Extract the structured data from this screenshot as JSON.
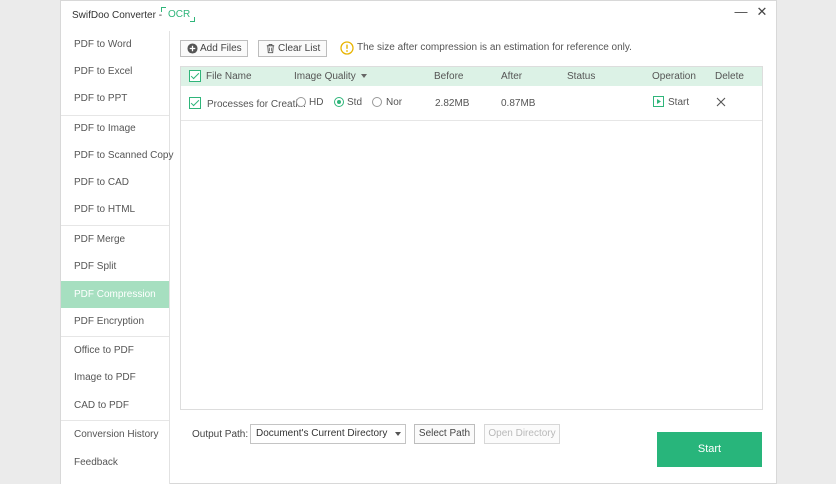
{
  "app": {
    "title": "SwifDoo Converter -",
    "ocr_label": "OCR"
  },
  "window_controls": {
    "minimize": "—",
    "close": "✕"
  },
  "sidebar": {
    "items": [
      {
        "label": "PDF to Word"
      },
      {
        "label": "PDF to Excel"
      },
      {
        "label": "PDF to PPT"
      },
      {
        "label": "PDF to Image"
      },
      {
        "label": "PDF to Scanned Copy"
      },
      {
        "label": "PDF to CAD"
      },
      {
        "label": "PDF to HTML"
      },
      {
        "label": "PDF Merge"
      },
      {
        "label": "PDF Split"
      },
      {
        "label": "PDF Compression"
      },
      {
        "label": "PDF Encryption"
      },
      {
        "label": "Office to PDF"
      },
      {
        "label": "Image to PDF"
      },
      {
        "label": "CAD to PDF"
      },
      {
        "label": "Conversion History"
      },
      {
        "label": "Feedback"
      }
    ],
    "active": "PDF Compression"
  },
  "toolbar": {
    "add_files": "Add Files",
    "clear_list": "Clear List",
    "notice": "The size after compression is an estimation for reference only."
  },
  "table": {
    "headers": {
      "file_name": "File Name",
      "image_quality": "Image Quality",
      "before": "Before",
      "after": "After",
      "status": "Status",
      "operation": "Operation",
      "delete": "Delete"
    },
    "rows": [
      {
        "file_name": "Processes for Creati...",
        "quality_options": [
          "HD",
          "Std",
          "Nor"
        ],
        "quality_selected": "Std",
        "before": "2.82MB",
        "after": "0.87MB",
        "status": "",
        "operation": "Start"
      }
    ]
  },
  "footer": {
    "output_path_label": "Output Path:",
    "output_path_value": "Document's Current Directory",
    "select_path": "Select Path",
    "open_directory": "Open Directory",
    "start": "Start"
  },
  "colors": {
    "accent": "#28b57b",
    "header_bg": "#dcf2e6",
    "active_sidebar": "#a6dfc0"
  }
}
